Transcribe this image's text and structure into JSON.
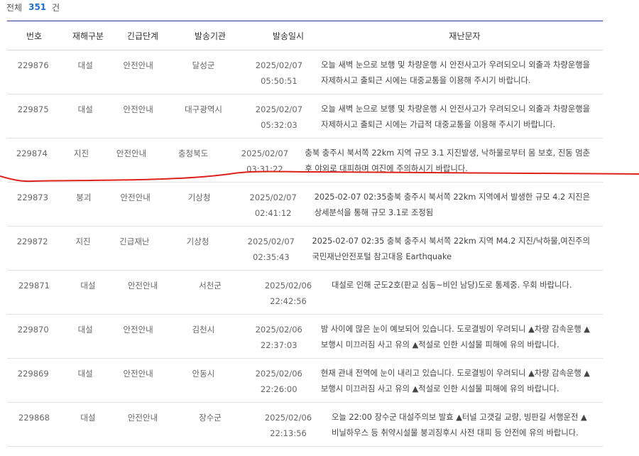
{
  "summary": {
    "label": "전체",
    "count": "351",
    "unit": "건"
  },
  "headers": {
    "no": "번호",
    "type": "재해구분",
    "level": "긴급단계",
    "org": "발송기관",
    "date": "발송일시",
    "msg": "재난문자"
  },
  "rows": [
    {
      "no": "229876",
      "type": "대설",
      "level": "안전안내",
      "org": "달성군",
      "date": "2025/02/07",
      "time": "05:50:51",
      "msg1": "오늘 새벽 눈으로 보행 및 차량운행 시 안전사고가 우려되오니 외출과 차량운행을",
      "msg2": "자제하시고 출퇴근 시에는 대중교통을 이용해 주시기 바랍니다."
    },
    {
      "no": "229875",
      "type": "대설",
      "level": "안전안내",
      "org": "대구광역시",
      "date": "2025/02/07",
      "time": "05:32:03",
      "msg1": "오늘 새벽 눈으로 보행 및 차량운행 시 안전사고가 우려되오니 외출과 차량운행을",
      "msg2": "자제하시고 출퇴근 시에는 가급적 대중교통을 이용해 주시기 바랍니다."
    },
    {
      "no": "229874",
      "type": "지진",
      "level": "안전안내",
      "org": "충청북도",
      "date": "2025/02/07",
      "time": "03:31:22",
      "msg1": "충북 충주시 북서쪽 22km 지역 규모 3.1 지진발생, 낙하물로부터 몸 보호, 진동 멈춘",
      "msg2": "후 야외로 대피하며 여진에 주의하시기 바랍니다."
    },
    {
      "no": "229873",
      "type": "붕괴",
      "level": "안전안내",
      "org": "기상청",
      "date": "2025/02/07",
      "time": "02:41:12",
      "msg1": "2025-02-07 02:35충북 충주시 북서쪽 22km 지역에서 발생한 규모 4.2 지진은",
      "msg2": "상세분석을 통해 규모 3.1로 조정됨"
    },
    {
      "no": "229872",
      "type": "지진",
      "level": "긴급재난",
      "org": "기상청",
      "date": "2025/02/07",
      "time": "02:35:43",
      "msg1": "2025-02-07 02:35 충북 충주시 북서쪽 22km 지역 M4.2 지진/낙하물,여진주의",
      "msg2": "국민재난안전포털 참고대응 Earthquake"
    },
    {
      "no": "229871",
      "type": "대설",
      "level": "안전안내",
      "org": "서천군",
      "date": "2025/02/06",
      "time": "22:42:56",
      "msg1": "대설로 인해 군도2호(판교 심동~비인 남당)도로 통제중. 우회 바랍니다.",
      "msg2": ""
    },
    {
      "no": "229870",
      "type": "대설",
      "level": "안전안내",
      "org": "김천시",
      "date": "2025/02/06",
      "time": "22:37:03",
      "msg1": "밤 사이에 많은 눈이 예보되어 있습니다. 도로결빙이 우려되니 ▲차량 감속운행 ▲",
      "msg2": "보행시 미끄러짐 사고 유의 ▲적설로 인한 시설물 피해에 유의 바랍니다."
    },
    {
      "no": "229869",
      "type": "대설",
      "level": "안전안내",
      "org": "안동시",
      "date": "2025/02/06",
      "time": "22:26:00",
      "msg1": "현재 관내 전역에 눈이 내리고 있습니다. 도로결빙이 우려되니 ▲차량 감속운행 ▲",
      "msg2": "보행시 미끄러짐 사고 유의 ▲적설로 인한 시설물 피해에 유의 바랍니다."
    },
    {
      "no": "229868",
      "type": "대설",
      "level": "안전안내",
      "org": "장수군",
      "date": "2025/02/06",
      "time": "22:13:56",
      "msg1": "오늘 22:00 장수군 대설주의보 발효 ▲터널 고갯길 교량, 빙판길 서행운전 ▲",
      "msg2": "비닐하우스 등 취약시설물 붕괴징후시 사전 대피 등 안전에 유의 바랍니다."
    }
  ],
  "colors": {
    "accent": "#1f6fc9",
    "header_border": "#2b3b8f",
    "annotation": "#e0201c"
  }
}
